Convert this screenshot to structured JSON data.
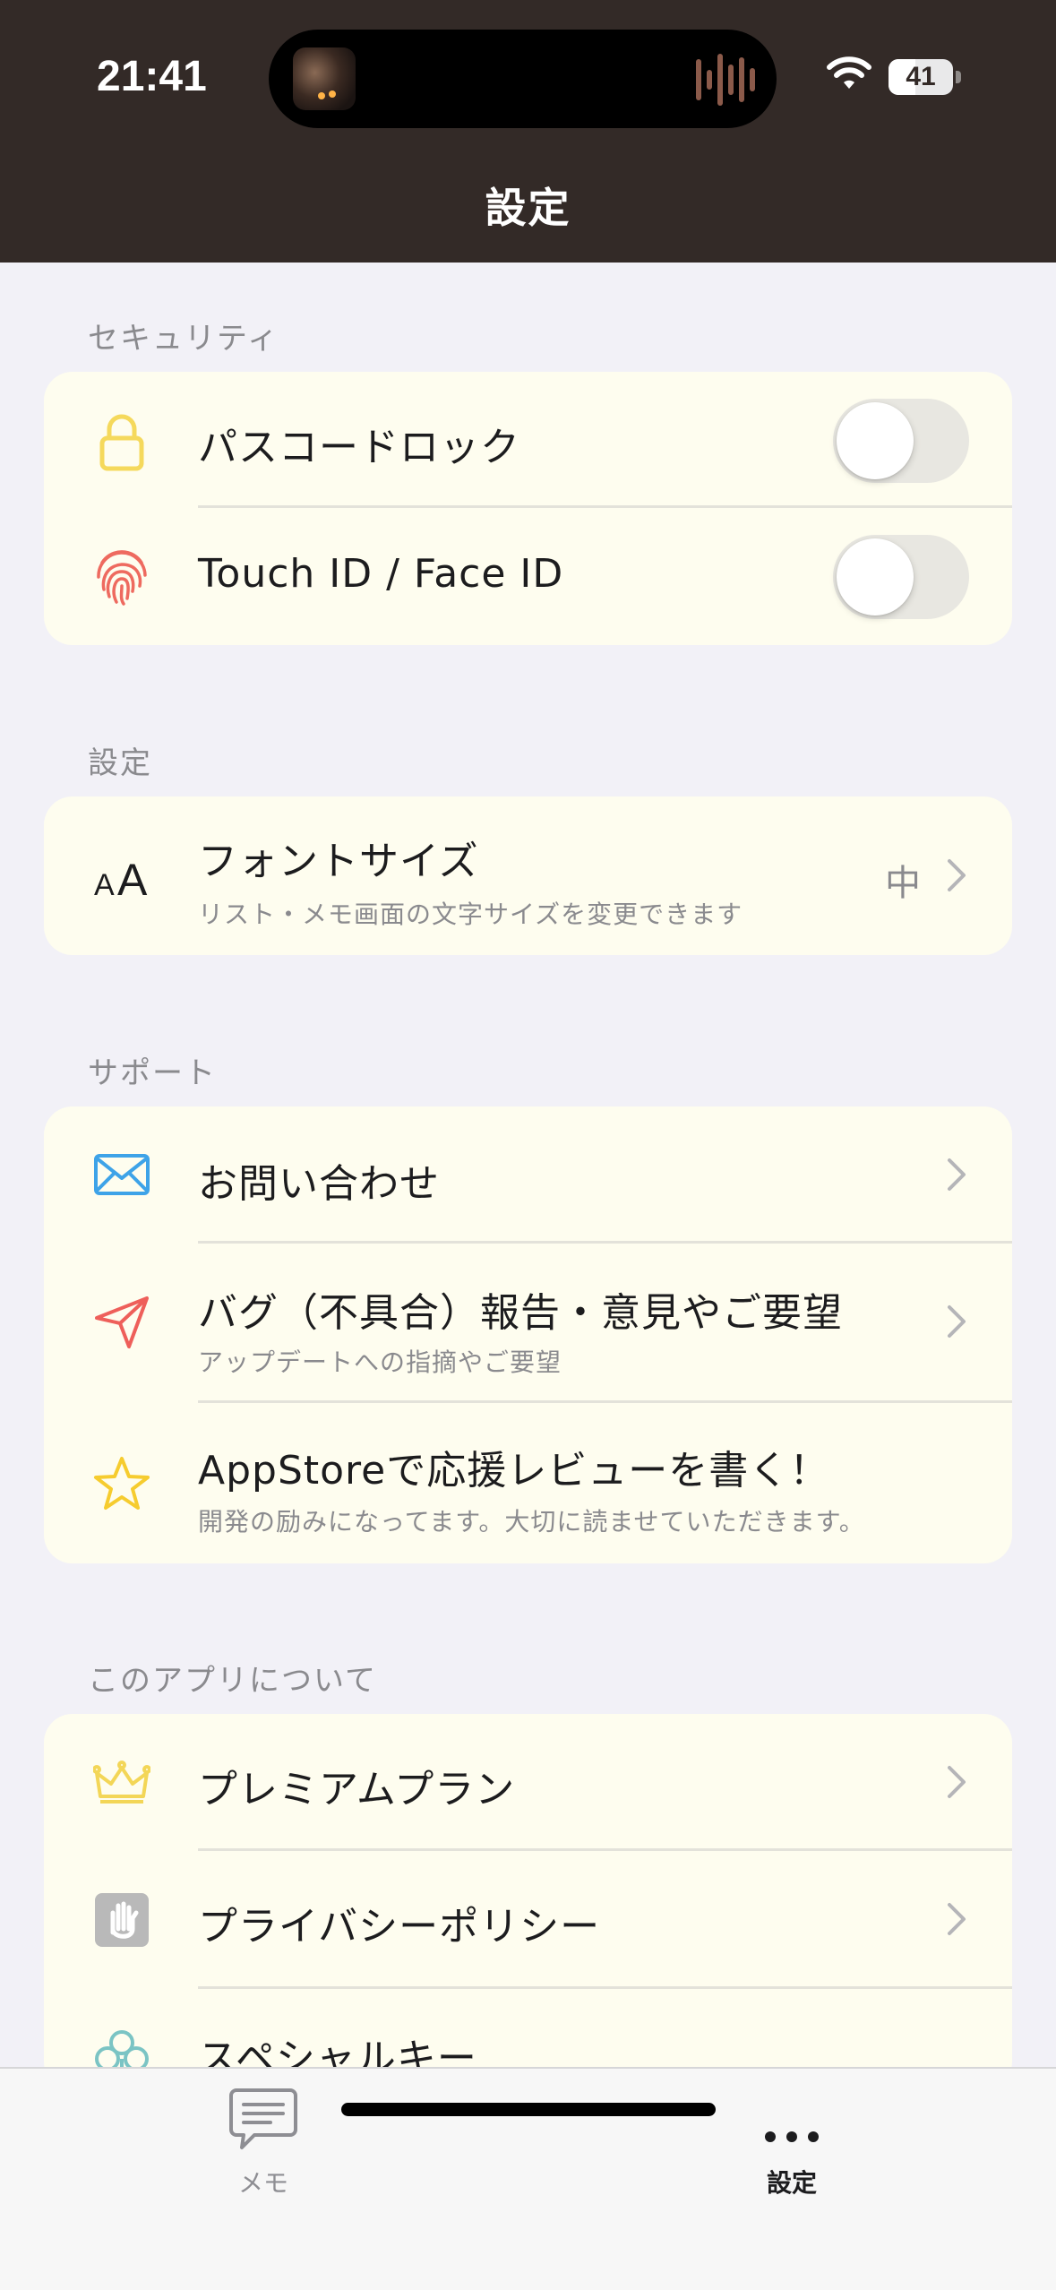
{
  "status_bar": {
    "time": "21:41",
    "battery": "41"
  },
  "nav": {
    "title": "設定"
  },
  "sections": {
    "security": {
      "label": "セキュリティ",
      "passcode_label": "パスコードロック",
      "passcode_on": false,
      "touchid_label": "Touch ID / Face ID",
      "touchid_on": false
    },
    "settings": {
      "label": "設定",
      "font_size_title": "フォントサイズ",
      "font_size_sub": "リスト・メモ画面の文字サイズを変更できます",
      "font_size_value": "中"
    },
    "support": {
      "label": "サポート",
      "contact_title": "お問い合わせ",
      "bug_title": "バグ（不具合）報告・意見やご要望",
      "bug_sub": "アップデートへの指摘やご要望",
      "review_title": "AppStoreで応援レビューを書く！",
      "review_sub": "開発の励みになってます。大切に読ませていただきます。"
    },
    "about": {
      "label": "このアプリについて",
      "premium_title": "プレミアムプラン",
      "privacy_title": "プライバシーポリシー",
      "special_title": "スペシャルキー"
    }
  },
  "tabbar": {
    "memo_label": "メモ",
    "settings_label": "設定"
  },
  "colors": {
    "header_bg": "#332a27",
    "card_bg": "#fefdef",
    "page_bg": "#f2f1f7",
    "lock_icon": "#f5d95c",
    "fingerprint_icon": "#ee6a5f",
    "mail_icon": "#3ea3e8",
    "send_icon": "#ee5f5a",
    "star_icon": "#f6cc2f",
    "crown_icon": "#f3d657",
    "hand_icon": "#b9b9b9",
    "clover_icon": "#7bc4c4"
  },
  "icons": [
    "lock-icon",
    "fingerprint-icon",
    "font-size-icon",
    "mail-icon",
    "send-icon",
    "star-icon",
    "crown-icon",
    "hand-icon",
    "clover-icon",
    "chevron-right-icon",
    "chat-bubble-icon",
    "ellipsis-icon",
    "wifi-icon",
    "battery-icon"
  ]
}
